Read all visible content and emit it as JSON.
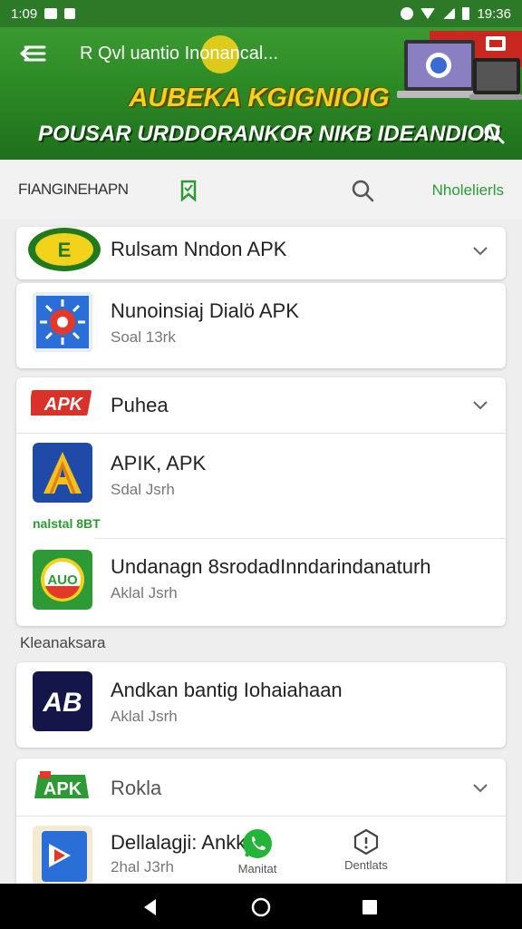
{
  "status_bar": {
    "time": "1:09",
    "clock": "19:36"
  },
  "header": {
    "title": "R Qvl uantio Inonancal...",
    "banner_line1": "AUBEKA KGIGNIOIG",
    "banner_line2": "POUSAR URDDORANKOR NIKB IDEANDION"
  },
  "toolbar": {
    "label": "FIANGINEHAPN",
    "action": "Nholelierls"
  },
  "cards": [
    {
      "type": "category",
      "title": "Rulsam Nndon APK",
      "items": []
    },
    {
      "type": "list",
      "items": [
        {
          "title": "Nunoinsiaj Dialö APK",
          "subtitle": "Soal 13rk"
        }
      ]
    },
    {
      "type": "category",
      "title": "Puhea",
      "items": [
        {
          "title": "APIK, APK",
          "subtitle": "Sdal Jsrh",
          "note": "nalstal 8BT"
        },
        {
          "title": "Undanagn 8srodadInndarindanaturh",
          "subtitle": "Aklal Jsrh"
        }
      ]
    },
    {
      "type": "list",
      "items": [
        {
          "title": "Andkan bantig Iohaiahaan",
          "subtitle": "Aklal Jsrh"
        }
      ]
    },
    {
      "type": "category",
      "title": "Rokla",
      "items": [
        {
          "title": "Dellalagji: Ankk",
          "subtitle": "2hal J3rh"
        }
      ]
    }
  ],
  "section_label": "Kleanaksara",
  "float_tabs": [
    {
      "label": "Manitat",
      "icon": "whatsapp-icon"
    },
    {
      "label": "Dentlats",
      "icon": "shield-icon"
    }
  ],
  "icon_logos": {
    "card0": "E",
    "card1_icon": "APK",
    "card1_item0": "A",
    "card1_item1": "AUO",
    "card2_item0": "AB",
    "card3_logo": "APK"
  },
  "colors": {
    "header_green": "#2c8a25",
    "accent_green": "#2d9a35",
    "banner_yellow": "#f4d21b"
  }
}
